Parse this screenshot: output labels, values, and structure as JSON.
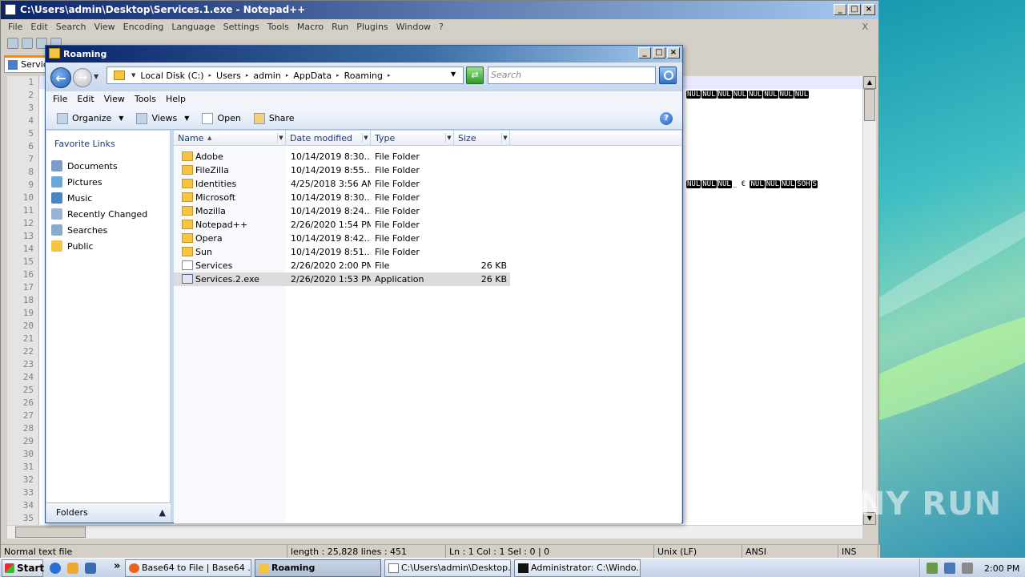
{
  "npp": {
    "title": "C:\\Users\\admin\\Desktop\\Services.1.exe - Notepad++",
    "menu": [
      "File",
      "Edit",
      "Search",
      "View",
      "Encoding",
      "Language",
      "Settings",
      "Tools",
      "Macro",
      "Run",
      "Plugins",
      "Window",
      "?"
    ],
    "close_x": "X",
    "tab": "Servic",
    "line_numbers": [
      "1",
      "2",
      "3",
      "4",
      "5",
      "6",
      "7",
      "8",
      "9",
      "10",
      "11",
      "12",
      "13",
      "14",
      "15",
      "16",
      "17",
      "18",
      "19",
      "20",
      "21",
      "22",
      "23",
      "24",
      "25",
      "26",
      "27",
      "28",
      "29",
      "30",
      "31",
      "32",
      "33",
      "34",
      "35"
    ],
    "line2_tail": [
      "NUL",
      "NUL",
      "NUL",
      "NUL",
      "NUL",
      "NUL",
      "NUL",
      "NUL"
    ],
    "line9_tail_a": [
      "NUL",
      "NUL",
      "NUL"
    ],
    "line9_mid": "_ €",
    "line9_tail_b": [
      "NUL",
      "NUL",
      "NUL"
    ],
    "line9_end": [
      "SOH",
      "S"
    ],
    "status": {
      "type": "Normal text file",
      "length": "length : 25,828    lines : 451",
      "pos": "Ln : 1    Col : 1    Sel : 0 | 0",
      "eol": "Unix (LF)",
      "enc": "ANSI",
      "ins": "INS"
    }
  },
  "explorer": {
    "title": "Roaming",
    "breadcrumb": [
      "Local Disk (C:)",
      "Users",
      "admin",
      "AppData",
      "Roaming"
    ],
    "search_placeholder": "Search",
    "menu": [
      "File",
      "Edit",
      "View",
      "Tools",
      "Help"
    ],
    "commands": {
      "organize": "Organize",
      "views": "Views",
      "open": "Open",
      "share": "Share"
    },
    "favorites_title": "Favorite Links",
    "favorites": [
      "Documents",
      "Pictures",
      "Music",
      "Recently Changed",
      "Searches",
      "Public"
    ],
    "folders_label": "Folders",
    "columns": {
      "name": "Name",
      "date": "Date modified",
      "type": "Type",
      "size": "Size"
    },
    "files": [
      {
        "name": "Adobe",
        "date": "10/14/2019 8:30...",
        "type": "File Folder",
        "size": "",
        "kind": "folder"
      },
      {
        "name": "FileZilla",
        "date": "10/14/2019 8:55...",
        "type": "File Folder",
        "size": "",
        "kind": "folder"
      },
      {
        "name": "Identities",
        "date": "4/25/2018 3:56 AM",
        "type": "File Folder",
        "size": "",
        "kind": "folder"
      },
      {
        "name": "Microsoft",
        "date": "10/14/2019 8:30...",
        "type": "File Folder",
        "size": "",
        "kind": "folder"
      },
      {
        "name": "Mozilla",
        "date": "10/14/2019 8:24...",
        "type": "File Folder",
        "size": "",
        "kind": "folder"
      },
      {
        "name": "Notepad++",
        "date": "2/26/2020 1:54 PM",
        "type": "File Folder",
        "size": "",
        "kind": "folder"
      },
      {
        "name": "Opera",
        "date": "10/14/2019 8:42...",
        "type": "File Folder",
        "size": "",
        "kind": "folder"
      },
      {
        "name": "Sun",
        "date": "10/14/2019 8:51...",
        "type": "File Folder",
        "size": "",
        "kind": "folder"
      },
      {
        "name": "Services",
        "date": "2/26/2020 2:00 PM",
        "type": "File",
        "size": "26 KB",
        "kind": "file"
      },
      {
        "name": "Services.2.exe",
        "date": "2/26/2020 1:53 PM",
        "type": "Application",
        "size": "26 KB",
        "kind": "exe",
        "selected": true
      }
    ]
  },
  "taskbar": {
    "start": "Start",
    "buttons": [
      {
        "label": "Base64 to File | Base64 ...",
        "icon": "firefox-icon",
        "active": false
      },
      {
        "label": "Roaming",
        "icon": "folder-icon",
        "active": true
      },
      {
        "label": "C:\\Users\\admin\\Desktop...",
        "icon": "notepadpp-icon",
        "active": false
      },
      {
        "label": "Administrator: C:\\Windo...",
        "icon": "cmd-icon",
        "active": false
      }
    ],
    "clock": "2:00 PM",
    "overflow": "»"
  },
  "watermark": "ANY RUN"
}
